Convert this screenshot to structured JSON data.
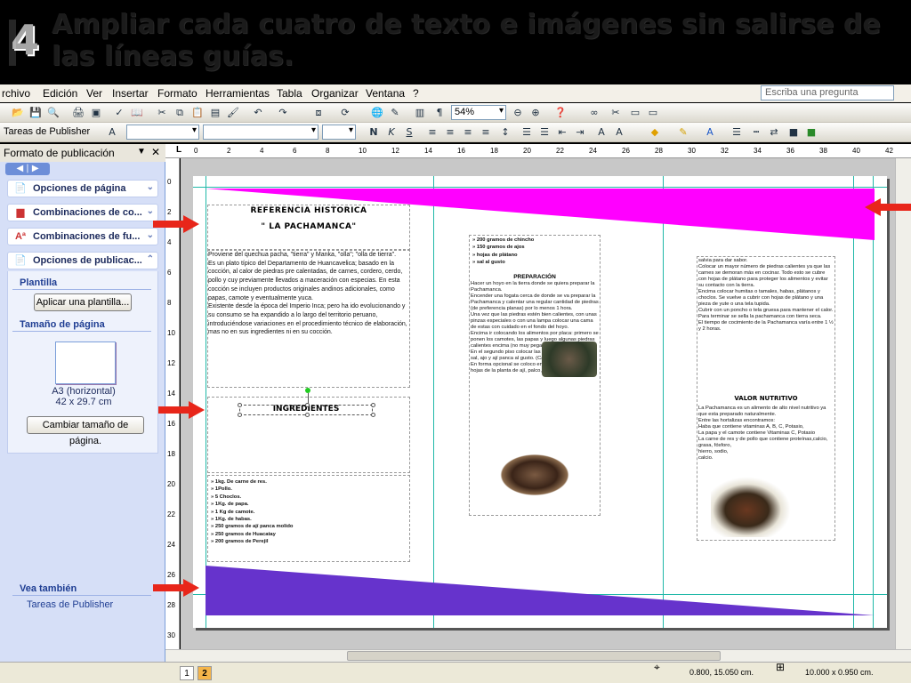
{
  "slide": {
    "step_number": "4",
    "title": "Ampliar cada cuatro de texto e imágenes sin salirse de las líneas guías."
  },
  "menu": {
    "items": [
      "rchivo",
      "Edición",
      "Ver",
      "Insertar",
      "Formato",
      "Herramientas",
      "Tabla",
      "Organizar",
      "Ventana",
      "?"
    ],
    "ask_placeholder": "Escriba una pregunta"
  },
  "toolbar": {
    "zoom": "54%",
    "tasks_label": "Tareas de Publisher",
    "font_name": "",
    "font_size": "",
    "bold": "N",
    "italic": "K",
    "underline": "S"
  },
  "taskpane": {
    "title": "Formato de publicación",
    "sections": [
      {
        "label": "Opciones de página",
        "icon": "page-icon"
      },
      {
        "label": "Combinaciones de co...",
        "icon": "color-scheme-icon"
      },
      {
        "label": "Combinaciones de fu...",
        "icon": "font-scheme-icon"
      },
      {
        "label": "Opciones de publicac...",
        "icon": "publication-icon"
      }
    ],
    "template_label": "Plantilla",
    "apply_template_button": "Aplicar una plantilla...",
    "page_size_label": "Tamaño de página",
    "page_size_name": "A3 (horizontal)",
    "page_size_dims": "42 x 29.7 cm",
    "change_size_button": "Cambiar tamaño de página.",
    "see_also_label": "Vea también",
    "see_also_link": "Tareas de Publisher"
  },
  "ruler": {
    "h_ticks": [
      "0",
      "2",
      "4",
      "6",
      "8",
      "10",
      "12",
      "14",
      "16",
      "18",
      "20",
      "22",
      "24",
      "26",
      "28",
      "30",
      "32",
      "34",
      "36",
      "38",
      "40",
      "42"
    ],
    "v_ticks": [
      "0",
      "2",
      "4",
      "6",
      "8",
      "10",
      "12",
      "14",
      "16",
      "18",
      "20",
      "22",
      "24",
      "26",
      "28",
      "30"
    ]
  },
  "status": {
    "pages": [
      "1",
      "2"
    ],
    "position": "0.800, 15.050 cm.",
    "size": "10.000 x  0.950 cm."
  },
  "document": {
    "heading1": "REFERENCIA HISTORICA",
    "heading2": "\" LA PACHAMANCA\"",
    "intro": "Proviene del quechua pacha, \"tierra\" y Manka, \"olla\"; \"olla de tierra\".\nEs un plato típico del Departamento de Huancavelica; basado en la cocción, al calor de piedras pre calentadas, de carnes, cordero, cerdo, pollo y cuy previamente llevados a maceración con especias. En esta cocción se incluyen productos originales andinos adicionales, como papas, camote y eventualmente yuca.\nExistente desde la época del Imperio Inca; pero ha ido evolucionando y su consumo se ha expandido a lo largo del territorio peruano, introduciéndose variaciones en el procedimiento técnico de elaboración, mas no en sus ingredientes ni en su cocción.",
    "ingredients_title": "INGREDIENTES",
    "ingredients": [
      "1kg. De carne de res.",
      "1Pollo.",
      "5 Choclos.",
      "1Kg. de papa.",
      "1 Kg de camote.",
      "1Kg. de habas.",
      "250 gramos de ají panca molido",
      "250 gramos de Huacatay",
      "200 gramos de Perejil"
    ],
    "col2_list": [
      "200 gramos de chincho",
      "150 gramos de ajos",
      "hojas de plátano",
      "sal al gusto"
    ],
    "prep_title": "PREPARACIÓN",
    "prep_text": "Hacer un hoyo en la tierra donde se quiera preparar la Pachamanca.\nEncender una fogata cerca de donde se va preparar la Pachamanca y calentar una regular cantidad de piedras (de preferencia planas) por lo menos 1 hora.\nUna vez que las piedras estén bien calientes, con unas pinzas especiales o con una lampa colocar una cama de estas con cuidado en el fondo del hoyo.\nEncima ir colocando los alimentos por placa: primero se ponen los camotes, las papas y luego algunas piedras calientes encima (no muy pegadas unas a otras).\nEn el segundo piso colocar las carnes aderezadas con sal, ajo y ají panca al gusto. (Carne y pollo).\nEn forma opcional se coloco encima de las carnes hojas de la planta de ají, palco, y",
    "col3_text": "salvia para dar sabor.\nColocar un mayor número de piedras calientes ya que las carnes se demoran más en cocinar. Todo esto se cubre con hojas de plátano para proteger los alimentos y evitar su contacto con la tierra.\nEncima colocar humitas o tamales, habas, plátanos y choclos. Se vuelve a cubrir con hojas de plátano y una pieza de yute o una tela tupida.\nCubrir con un poncho o tela gruesa para mantener el calor. Para terminar se sella la pachamanca con tierra seca.\nEl tiempo de cocimiento de la Pachamanca varía entre 1 ½ y 2 horas.",
    "nutri_title": "VALOR NUTRITIVO",
    "nutri_text": "La Pachamanca es un alimento de alto nivel nutritivo ya que esta preparado naturalmente.\nEntre las hortalizas encontramos:\nHaba que contiene vitaminas A, B, C, Potasio,\nLa papa y el camote contiene Vitaminas C, Potasio\nLa carne de res y de pollo que contiene proteínas,calcio,\ngrasa, fósforo,\nhierro, sodio,\ncalcio."
  },
  "colors": {
    "banner_top": "#ff00ff",
    "banner_bottom": "#6633cc",
    "arrow": "#e8261a",
    "guide": "#1fb8a8"
  }
}
